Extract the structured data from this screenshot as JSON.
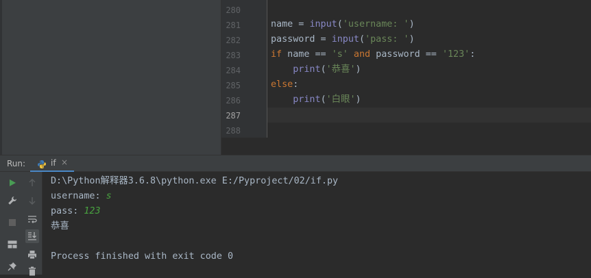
{
  "editor": {
    "line_numbers": [
      "280",
      "281",
      "282",
      "283",
      "284",
      "285",
      "286",
      "287",
      "288"
    ],
    "current_line": "287",
    "code": {
      "line281": {
        "var": "name",
        "op": " = ",
        "fn": "input",
        "open": "(",
        "str": "'username: '",
        "close": ")"
      },
      "line282": {
        "var": "password",
        "op": " = ",
        "fn": "input",
        "open": "(",
        "str": "'pass: '",
        "close": ")"
      },
      "line283": {
        "kw_if": "if",
        "cond1": " name == ",
        "str1": "'s'",
        "kw_and": " and",
        "cond2": " password == ",
        "str2": "'123'",
        "colon": ":"
      },
      "line284": {
        "indent": "    ",
        "fn": "print",
        "open": "(",
        "str": "'恭喜'",
        "close": ")"
      },
      "line285": {
        "kw_else": "else",
        "colon": ":"
      },
      "line286": {
        "indent": "    ",
        "fn": "print",
        "open": "(",
        "str": "'白眼'",
        "close": ")"
      }
    }
  },
  "run_panel": {
    "label": "Run:",
    "tab_label": "if",
    "tab_close": "×",
    "console": {
      "cmd": "D:\\Python解释器3.6.8\\python.exe E:/Pyproject/02/if.py",
      "prompt_username": "username: ",
      "input_username": "s",
      "prompt_pass": "pass: ",
      "input_pass": "123",
      "output": "恭喜",
      "exit_message": "Process finished with exit code 0"
    }
  },
  "icons": {
    "toolbar_left": [
      "run-icon",
      "wrench-icon",
      "stop-icon",
      "layout-icon",
      "pin-icon"
    ],
    "toolbar_right": [
      "up-arrow-icon",
      "down-arrow-icon",
      "soft-wrap-icon",
      "scroll-to-end-icon",
      "print-icon",
      "trash-icon"
    ]
  },
  "colors": {
    "keyword": "#cc7832",
    "string": "#6a8759",
    "builtin": "#8888c6",
    "user_input": "#49a340",
    "run_green": "#499c54",
    "tab_underline": "#4a88c7"
  }
}
